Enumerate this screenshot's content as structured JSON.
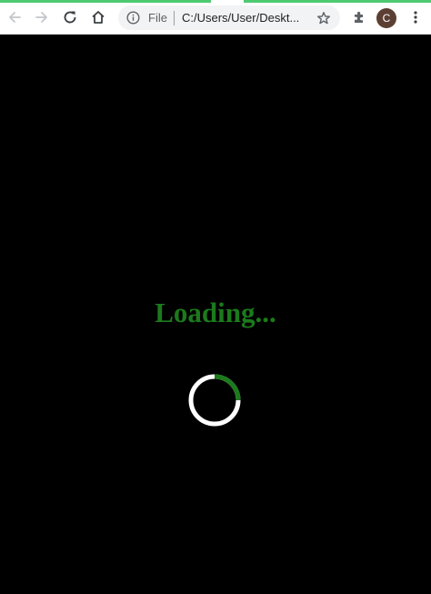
{
  "browser": {
    "omnibox": {
      "scheme_label": "File",
      "url": "C:/Users/User/Deskt..."
    },
    "profile_initial": "C",
    "colors": {
      "load_bar": "#4ecb71",
      "icon": "#5f6368",
      "omnibox_bg": "#f1f3f4",
      "avatar_bg": "#5c3f33"
    },
    "icons": [
      "back-icon",
      "forward-icon",
      "reload-icon",
      "home-icon",
      "info-icon",
      "star-icon",
      "extensions-icon",
      "menu-icon"
    ]
  },
  "page": {
    "loading_text": "Loading...",
    "colors": {
      "background": "#000000",
      "text": "#1c7a1c",
      "spinner_track": "#ffffff",
      "spinner_arc": "#1c7a1c"
    }
  }
}
